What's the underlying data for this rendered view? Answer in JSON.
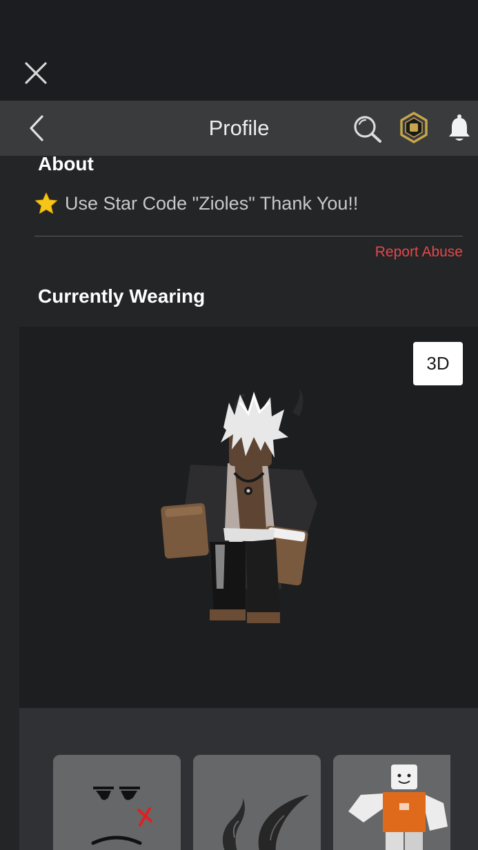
{
  "header": {
    "title": "Profile"
  },
  "about": {
    "heading": "About",
    "text": "Use Star Code \"Zioles\" Thank You!!",
    "report_label": "Report Abuse"
  },
  "wearing": {
    "heading": "Currently Wearing",
    "view_toggle_label": "3D",
    "items": [
      {
        "icon": "face-item-icon"
      },
      {
        "icon": "horns-item-icon"
      },
      {
        "icon": "avatar-outfit-item-icon"
      }
    ]
  },
  "colors": {
    "accent_report": "#e5474b",
    "header_bg": "#393b3d",
    "page_bg": "#232527",
    "robux_gold": "#c8a64b"
  }
}
